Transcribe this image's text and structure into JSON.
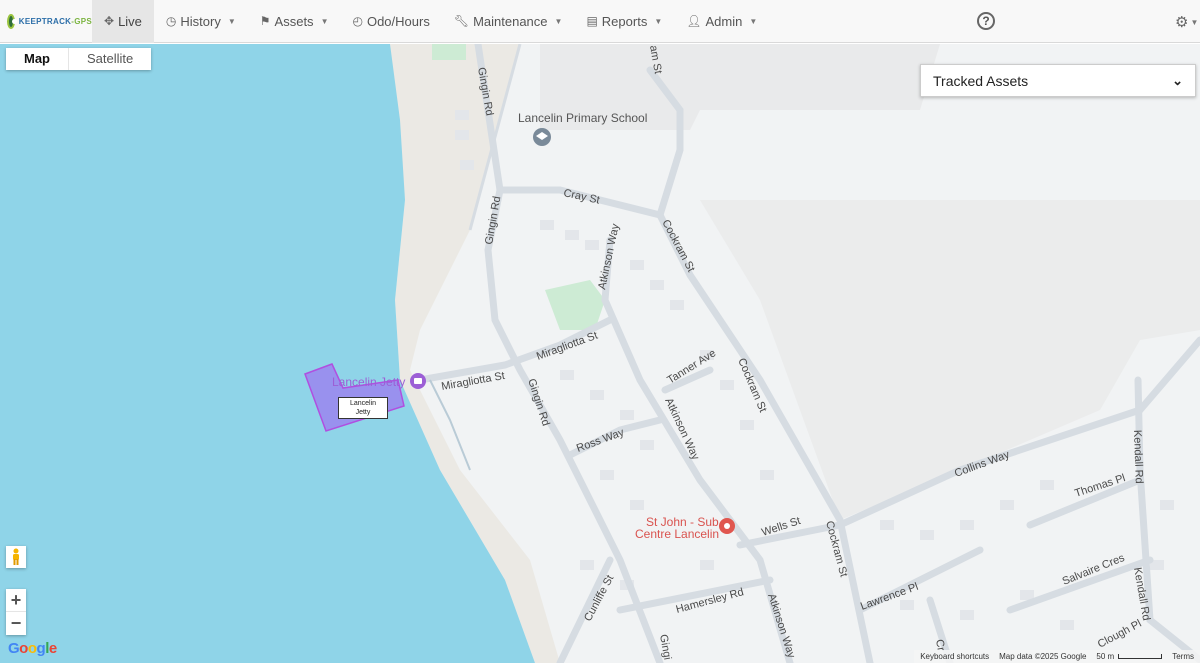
{
  "brand": {
    "part1": "KEEPTRACK",
    "part2": "-GPS"
  },
  "nav": {
    "live": "Live",
    "history": "History",
    "assets": "Assets",
    "odo": "Odo/Hours",
    "maintenance": "Maintenance",
    "reports": "Reports",
    "admin": "Admin"
  },
  "map_type": {
    "map": "Map",
    "satellite": "Satellite"
  },
  "tracked_assets": {
    "label": "Tracked Assets"
  },
  "map_labels": {
    "school": "Lancelin Primary School",
    "cray": "Cray St",
    "gingin1": "Gingin Rd",
    "gingin2": "Gingin Rd",
    "gingin3": "Gingin Rd",
    "gingin4": "Gingi",
    "atkinson1": "Atkinson Way",
    "atkinson2": "Atkinson Way",
    "atkinson3": "Atkinson Way",
    "cockram1": "Cockram St",
    "cockram2": "Cockram St",
    "cockram3": "Cockram St",
    "cockram_top": "am St",
    "miragliotta1": "Miragliotta St",
    "miragliotta2": "Miragliotta St",
    "tanner": "Tanner Ave",
    "jetty_poi": "Lancelin Jetty",
    "ross": "Ross Way",
    "stjohn1": "St John - Sub",
    "stjohn2": "Centre Lancelin",
    "wells": "Wells St",
    "collins": "Collins Way",
    "kendall1": "Kendall Rd",
    "kendall2": "Kendall Rd",
    "thomas": "Thomas Pl",
    "salvaire": "Salvaire Cres",
    "lawrence": "Lawrence Pl",
    "hamersley": "Hamersley Rd",
    "cunliffe": "Cunliffe St",
    "clough": "Clough Pl",
    "cr": "Cr"
  },
  "geofence_label": {
    "line1": "Lancelin",
    "line2": "Jetty"
  },
  "footer": {
    "shortcuts": "Keyboard shortcuts",
    "mapdata": "Map data ©2025 Google",
    "scale": "50 m",
    "terms": "Terms"
  },
  "google_logo": "Google",
  "colors": {
    "water": "#8fd4e8",
    "land": "#f1f3f4",
    "sand": "#e9e7e2",
    "road": "#d7dde3",
    "geofence": "#9c7bf0",
    "poi_school": "#7a8a99",
    "poi_medical": "#e0564f",
    "poi_jetty": "#9c5fd6"
  }
}
